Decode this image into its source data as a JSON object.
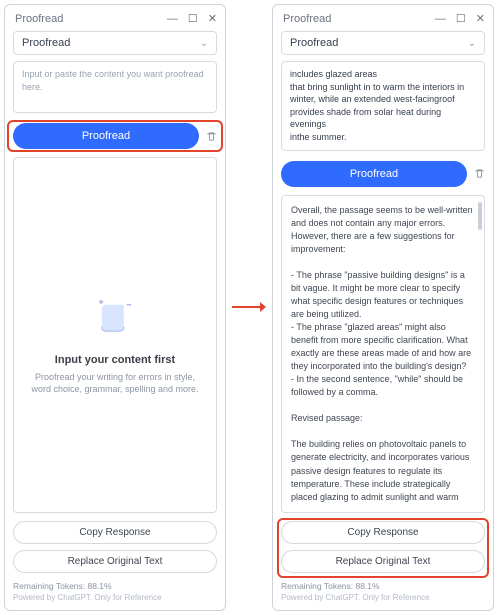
{
  "colors": {
    "accent": "#2f6bff",
    "highlight": "#e0452c"
  },
  "window": {
    "title": "Proofread",
    "min": "—",
    "max": "☐",
    "close": "✕"
  },
  "mode": {
    "label": "Proofread"
  },
  "left": {
    "placeholder": "Input or paste the content you want proofread here.",
    "button": "Proofread",
    "empty_title": "Input your content first",
    "empty_sub": "Proofread your writing for errors in style, word choice, grammar, spelling and more."
  },
  "right": {
    "input_text": "includes glazed areas\nthat bring sunlight in to warm the interiors in winter, while an extended west-facingroof provides shade from solar heat during evenings\ninthe summer.",
    "button": "Proofread",
    "result_text": "Overall, the passage seems to be well-written and does not contain any major errors. However, there are a few suggestions for improvement:\n\n- The phrase \"passive building designs\" is a bit vague. It might be more clear to specify what specific design features or techniques are being utilized.\n- The phrase \"glazed areas\" might also benefit from more specific clarification. What exactly are these areas made of and how are they incorporated into the building's design?\n- In the second sentence, \"while\" should be followed by a comma.\n\nRevised passage:\n\nThe building relies on photovoltaic panels to generate electricity, and incorporates various passive design features to regulate its temperature. These include strategically placed glazing to admit sunlight and warm"
  },
  "buttons": {
    "copy": "Copy Response",
    "replace": "Replace Original Text"
  },
  "footer": {
    "tokens": "Remaining Tokens: 88.1%",
    "powered": "Powered by ChatGPT. Only for Reference"
  }
}
